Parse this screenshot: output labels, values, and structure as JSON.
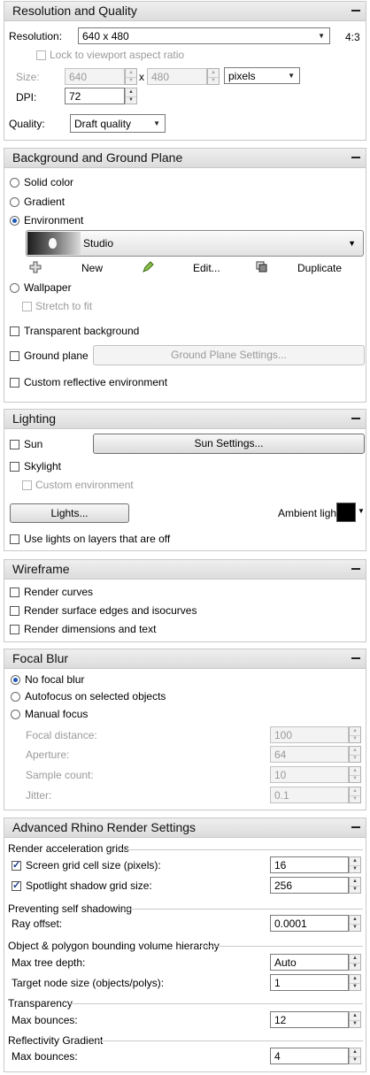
{
  "resolution_panel": {
    "title": "Resolution and Quality",
    "resolution_label": "Resolution:",
    "resolution_value": "640 x 480",
    "aspect": "4:3",
    "lock_label": "Lock to viewport aspect ratio",
    "size_label": "Size:",
    "width": "640",
    "times": "x",
    "height": "480",
    "units": "pixels",
    "dpi_label": "DPI:",
    "dpi": "72",
    "quality_label": "Quality:",
    "quality": "Draft quality"
  },
  "background_panel": {
    "title": "Background and Ground Plane",
    "solid_color": "Solid color",
    "gradient": "Gradient",
    "environment": "Environment",
    "env_name": "Studio",
    "new_label": "New",
    "edit_label": "Edit...",
    "duplicate_label": "Duplicate",
    "wallpaper": "Wallpaper",
    "stretch": "Stretch to fit",
    "transparent": "Transparent background",
    "ground_plane": "Ground plane",
    "ground_plane_settings": "Ground Plane Settings...",
    "custom_reflective": "Custom reflective environment"
  },
  "lighting_panel": {
    "title": "Lighting",
    "sun": "Sun",
    "sun_settings": "Sun Settings...",
    "skylight": "Skylight",
    "custom_env": "Custom environment",
    "lights_button": "Lights...",
    "ambient_label": "Ambient light:",
    "ambient_color": "#000000",
    "use_lights": "Use lights on layers that are off"
  },
  "wireframe_panel": {
    "title": "Wireframe",
    "curves": "Render curves",
    "edges": "Render surface edges and isocurves",
    "dimensions": "Render dimensions and text"
  },
  "focal_panel": {
    "title": "Focal Blur",
    "no_focal": "No focal blur",
    "autofocus": "Autofocus on selected objects",
    "manual": "Manual focus",
    "focal_distance_label": "Focal distance:",
    "focal_distance": "100",
    "aperture_label": "Aperture:",
    "aperture": "64",
    "sample_count_label": "Sample count:",
    "sample_count": "10",
    "jitter_label": "Jitter:",
    "jitter": "0.1"
  },
  "advanced_panel": {
    "title": "Advanced Rhino Render Settings",
    "accel_header": "Render acceleration grids",
    "screen_grid_label": "Screen grid cell size (pixels):",
    "screen_grid": "16",
    "spot_grid_label": "Spotlight shadow grid size:",
    "spot_grid": "256",
    "self_shadow_header": "Preventing self shadowing",
    "ray_offset_label": "Ray offset:",
    "ray_offset": "0.0001",
    "bvh_header": "Object & polygon bounding volume hierarchy",
    "max_depth_label": "Max tree depth:",
    "max_depth": "Auto",
    "target_node_label": "Target node size (objects/polys):",
    "target_node": "1",
    "transparency_header": "Transparency",
    "trans_bounces_label": "Max bounces:",
    "trans_bounces": "12",
    "reflect_header": "Reflectivity Gradient",
    "reflect_bounces_label": "Max bounces:",
    "reflect_bounces": "4"
  },
  "icons": {
    "collapse": "minus-icon",
    "dropdown": "chevron-down-icon",
    "new": "plus-icon",
    "edit": "pencil-icon",
    "duplicate": "copy-icon"
  }
}
